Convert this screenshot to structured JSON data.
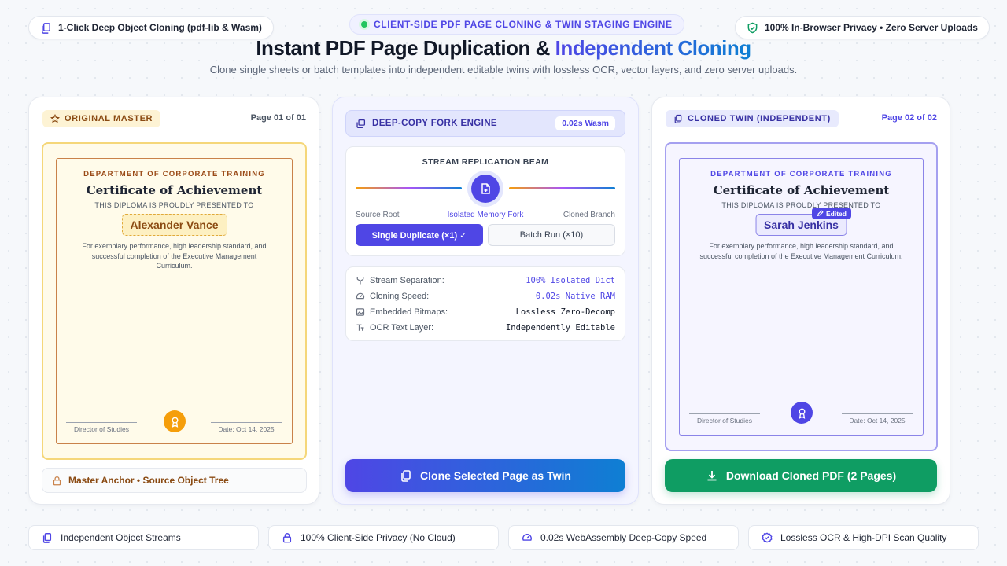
{
  "header": {
    "left_pill": "1-Click Deep Object Cloning (pdf-lib & Wasm)",
    "right_pill": "100% In-Browser Privacy • Zero Server Uploads",
    "eyebrow": "CLIENT-SIDE PDF PAGE CLONING & TWIN STAGING ENGINE",
    "title_main": "Instant PDF Page Duplication & ",
    "title_accent": "Independent Cloning",
    "subtitle": "Clone single sheets or batch templates into independent editable twins with lossless OCR, vector layers, and zero server uploads."
  },
  "original": {
    "tag": "ORIGINAL MASTER",
    "page": "Page 01 of 01",
    "certificate": {
      "dept": "DEPARTMENT OF CORPORATE TRAINING",
      "title": "Certificate of Achievement",
      "presented": "THIS DIPLOMA IS PROUDLY PRESENTED TO",
      "name": "Alexander Vance",
      "body": "For exemplary performance, high leadership standard, and successful completion of the Executive Management Curriculum.",
      "sig_left": "Director of Studies",
      "sig_right": "Date: Oct 14, 2025"
    },
    "footer": "Master Anchor • Source Object Tree"
  },
  "engine": {
    "tag": "DEEP-COPY FORK ENGINE",
    "speed_badge": "0.02s Wasm",
    "beam_title": "STREAM REPLICATION BEAM",
    "label_source": "Source Root",
    "label_fork": "Isolated Memory Fork",
    "label_branch": "Cloned Branch",
    "btn_single": "Single Duplicate (×1) ✓",
    "btn_batch": "Batch Run (×10)",
    "stats": [
      {
        "label": "Stream Separation:",
        "value": "100% Isolated Dict",
        "icon": "fork-icon"
      },
      {
        "label": "Cloning Speed:",
        "value": "0.02s Native RAM",
        "icon": "gauge-icon"
      },
      {
        "label": "Embedded Bitmaps:",
        "value": "Lossless Zero-Decomp",
        "icon": "image-icon"
      },
      {
        "label": "OCR Text Layer:",
        "value": "Independently Editable",
        "icon": "text-icon"
      }
    ],
    "clone_button": "Clone Selected Page as Twin"
  },
  "twin": {
    "tag": "CLONED TWIN (INDEPENDENT)",
    "page": "Page 02 of 02",
    "edited_badge": "Edited",
    "certificate": {
      "dept": "DEPARTMENT OF CORPORATE TRAINING",
      "title": "Certificate of Achievement",
      "presented": "THIS DIPLOMA IS PROUDLY PRESENTED TO",
      "name": "Sarah Jenkins",
      "body": "For exemplary performance, high leadership standard, and successful completion of the Executive Management Curriculum.",
      "sig_left": "Director of Studies",
      "sig_right": "Date: Oct 14, 2025"
    },
    "download_button": "Download Cloned PDF (2 Pages)"
  },
  "features": [
    "Independent Object Streams",
    "100% Client-Side Privacy (No Cloud)",
    "0.02s WebAssembly Deep-Copy Speed",
    "Lossless OCR & High-DPI Scan Quality"
  ],
  "colors": {
    "accent": "#4f46e5",
    "gold": "#8a4a12",
    "green": "#0f9d63",
    "blue": "#0e7fd3"
  }
}
